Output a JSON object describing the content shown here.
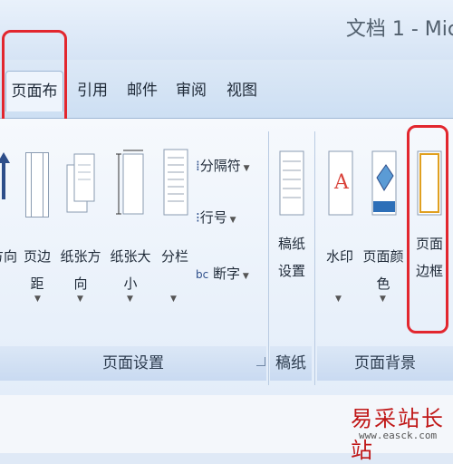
{
  "window": {
    "title": "文档 1 - Mic"
  },
  "tabs": [
    {
      "label": "页面布局",
      "active": true
    },
    {
      "label": "引用"
    },
    {
      "label": "邮件"
    },
    {
      "label": "审阅"
    },
    {
      "label": "视图"
    }
  ],
  "ribbon": {
    "page_setup": {
      "label": "页面设置",
      "buttons": {
        "text_direction": "方向",
        "margins": "页边距",
        "orientation": "纸张方向",
        "size": "纸张大小",
        "columns": "分栏"
      },
      "small": {
        "breaks": "分隔符",
        "line_numbers": "行号",
        "hyphenation": "断字"
      }
    },
    "draft_paper": {
      "label": "稿纸",
      "button": "稿纸\n设置"
    },
    "page_background": {
      "label": "页面背景",
      "buttons": {
        "watermark": "水印",
        "page_color": "页面颜色",
        "page_borders": "页面\n边框"
      }
    }
  },
  "watermark": {
    "main": "易采站长站",
    "sub": "www.easck.com"
  },
  "colors": {
    "highlight": "#e2262e",
    "ribbon_bg": "#e3edf9"
  }
}
